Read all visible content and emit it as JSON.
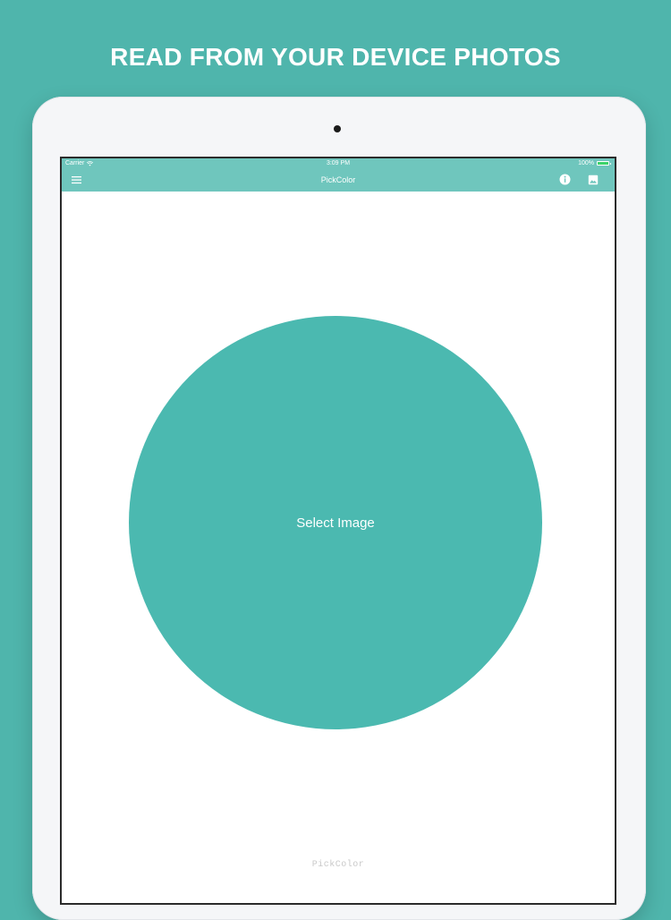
{
  "headline": "READ FROM YOUR DEVICE PHOTOS",
  "status_bar": {
    "carrier": "Carrier",
    "time": "3:09 PM",
    "battery": "100%"
  },
  "nav": {
    "title": "PickColor",
    "left_icon": "hamburger-menu-icon",
    "right_icons": [
      "info-icon",
      "photo-icon"
    ]
  },
  "main": {
    "select_label": "Select Image"
  },
  "footer": {
    "brand": "PickColor"
  },
  "colors": {
    "background": "#4fb5ac",
    "nav_bar": "#6fc6bd",
    "circle": "#4bb9b0",
    "screen": "#ffffff",
    "device_frame": "#f5f6f8"
  }
}
